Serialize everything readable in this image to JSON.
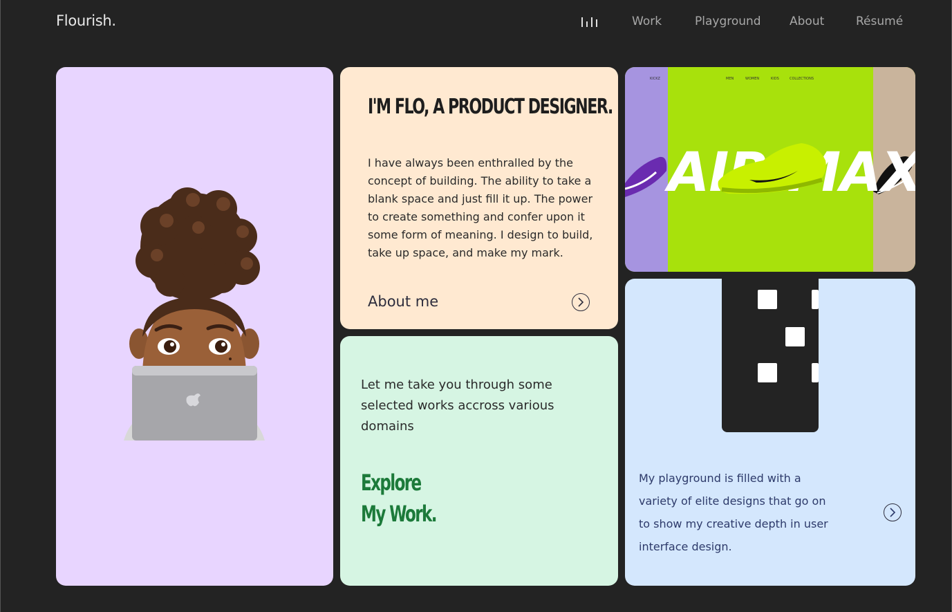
{
  "header": {
    "logo": "Flourish.",
    "nav": [
      {
        "label": "Work"
      },
      {
        "label": "Playground"
      },
      {
        "label": "About"
      },
      {
        "label": "Résumé"
      }
    ]
  },
  "intro": {
    "title": "I'M FLO, A PRODUCT DESIGNER.",
    "body": "I have always been enthralled by the concept of building. The ability to take a blank space and just fill it up. The power to create something and confer upon it some form of meaning. I design to build, take up space, and make my mark.",
    "link": "About me"
  },
  "work": {
    "body": "Let me take you through some selected works accross various domains",
    "cta_line1": "Explore",
    "cta_line2": "My Work."
  },
  "shoe": {
    "brand": "KICKZ",
    "nav": [
      "MEN",
      "WOMEN",
      "KIDS",
      "COLLECTIONS"
    ],
    "headline": "AIR MAX"
  },
  "playground": {
    "body": "My playground is filled with a variety of elite designs that go on to show my creative depth in user interface design."
  },
  "colors": {
    "background": "#232323",
    "avatar_card": "#e8d5ff",
    "intro_card": "#ffe9d1",
    "work_card": "#d6f5e3",
    "shoe_card": "#a8e10c",
    "play_card": "#d4e7fd",
    "work_cta": "#1c7a3a"
  }
}
